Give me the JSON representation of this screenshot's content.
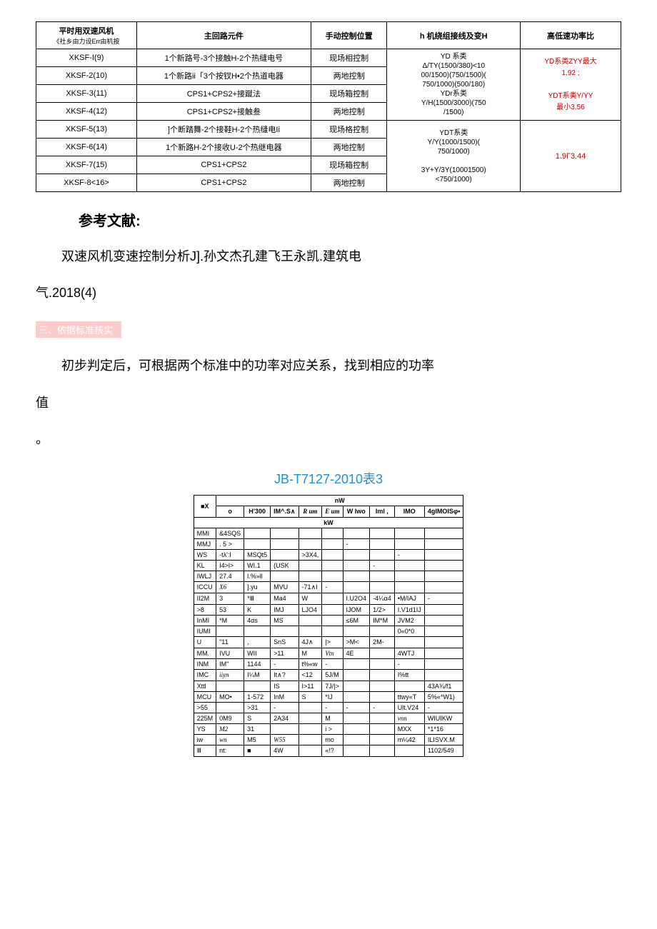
{
  "table1": {
    "headers": {
      "c1a": "平时用双速风机",
      "c1b": "《社乡由力设Err由机按",
      "c2": "主回路元件",
      "c3": "手动控制位置",
      "c4": "h 机绕组接线及变H",
      "c5": "高低速功率比"
    },
    "rows": [
      {
        "c1": "XKSF-I(9)",
        "c2": "1个新路号-3个接触H-2个热缝电号",
        "c3": "现场相控制"
      },
      {
        "c1": "XKSF-2(10)",
        "c2": "1个新路ii「3个按钗H•2个热道电器",
        "c3": "两地控制"
      },
      {
        "c1": "XKSF-3(11)",
        "c2": "CPS1+CPS2+接蹴法",
        "c3": "现场箱控制"
      },
      {
        "c1": "XKSF-4(12)",
        "c2": "CPS1+CPS2+接触叁",
        "c3": "两地控制"
      },
      {
        "c1": "XKSF-5(13)",
        "c2": "]个断踏舞-2个接鞋H-2个热缝电Ii",
        "c3": "现场格控制"
      },
      {
        "c1": "XKSF-6(14)",
        "c2": "1个新路H-2个接收U-2个热继电器",
        "c3": "两地控制"
      },
      {
        "c1": "XKSF-7(15)",
        "c2": "CPS1+CPS2",
        "c3": "现场箱控制"
      },
      {
        "c1": "XKSF-8<16>",
        "c2": "CPS1+CPS2",
        "c3": "两地控制"
      }
    ],
    "group1_c4": "YD 系类\nΔ/TY(1500/380)<10\n00/1500)(750/1500)(\n750/1000)(500/180)\nYDr系类\nY/H(1500/3000)(750\n/1500)",
    "group1_c5a": "YD系类ZYY最大",
    "group1_c5b": "1.92 ;",
    "group1_c5c": "YDT系类Y/YY",
    "group1_c5d": "最小3.56",
    "group2_c4": "YDT系类\nY/Y(1000/1500)(\n750/1000)\n\n3Y+Y/3Y(10001500)\n<750/1000)",
    "group2_c5": "1.9Г3.44"
  },
  "refs_title": "参考文献:",
  "refs_line1": "双速风机变速控制分析J].孙文杰孔建飞王永凯.建筑电",
  "refs_line2": "气.2018(4)",
  "section3": "三、依据标准核实",
  "para1": "初步判定后，可根据两个标准中的功率对应关系，找到相应的功率",
  "para2": "值",
  "para3": "。",
  "figTitle": "JB-T7127-2010表3",
  "table2": {
    "headRow1": {
      "hx": "■X",
      "hnw": "nW"
    },
    "headRow2": {
      "h1": "o",
      "h2": "H'300",
      "h3": "IM^.S∧",
      "h4": "R um",
      "h5": "E um",
      "h6": "W Iwo",
      "h7": "Iml ,",
      "h8": "IMO",
      "h9": "4gIMOISφ•"
    },
    "headRow3": {
      "kw": "kW"
    },
    "rows": [
      [
        "MMI",
        "&4SQS",
        "",
        "",
        "",
        "",
        "",
        "",
        "",
        ""
      ],
      [
        "MMJ",
        ". 5 >",
        "",
        "",
        "",
        "",
        "-",
        "",
        "",
        ""
      ],
      [
        "WS",
        "-tλ':I",
        "MSQt5",
        "",
        ">3X4,",
        "",
        "",
        "",
        "-",
        ""
      ],
      [
        "KL",
        "I4>l>",
        "WI.1",
        "(USK",
        "",
        "",
        "",
        "-",
        "",
        ""
      ],
      [
        "IWLJ",
        "27.4",
        "l.%»ll",
        "",
        "",
        "",
        "",
        "",
        "",
        ""
      ],
      [
        "ICCU",
        "X6",
        "].yu",
        "MVU",
        "-71∧I",
        "-",
        "",
        "",
        "",
        ""
      ],
      [
        "II2M",
        "3",
        "*Ⅲ",
        "Ma4",
        "W",
        "",
        "I.U2O4",
        "-4¼α4",
        "•M/IAJ",
        "-"
      ],
      [
        ">8",
        "53",
        "K",
        "IMJ",
        "LJO4",
        "",
        "IJOM",
        "1/2>",
        "I.V1d1IJ",
        ""
      ],
      [
        "InMI",
        "*M",
        "4αs",
        "MS",
        "",
        "",
        "≤6M",
        "IM*M",
        "JVM2",
        ""
      ],
      [
        "IUMI",
        "",
        "",
        "",
        "",
        "",
        "",
        "",
        "0«0*0",
        ""
      ],
      [
        "U",
        "\"11",
        ",",
        "SnS",
        "4J∧",
        "|>",
        ">M<",
        "2M-",
        "",
        ""
      ],
      [
        "MM.",
        "IVU",
        "WII",
        ">11",
        "M",
        "Vtn",
        "4E",
        "",
        "4WTJ",
        ""
      ],
      [
        "INM",
        "IM\"",
        "1144",
        "-",
        "t%«w",
        "-",
        "",
        "",
        "-",
        ""
      ],
      [
        "IMC",
        "iiyn",
        "I¼M",
        "It∧?",
        "<12",
        "5J/M",
        "",
        "",
        "I%tt",
        ""
      ],
      [
        "Xttl",
        "",
        "",
        "IS",
        "I>11",
        "7J/|>",
        "",
        "",
        "",
        "43A¾/f1"
      ],
      [
        "MCU",
        "MO•",
        "1-572",
        "InM",
        "S",
        "*IJ",
        "",
        "",
        "ttwy«T",
        "5%«*W1)"
      ],
      [
        ">55",
        "",
        ">31",
        "-",
        "",
        "-",
        "-",
        "-",
        "Ult.V24",
        "-"
      ],
      [
        "225M",
        "0M9",
        "S",
        "2A34",
        "",
        "M",
        "",
        "",
        "vnn",
        "WIUIKW"
      ],
      [
        "YS",
        "M2",
        "31",
        "",
        "",
        "i >",
        "",
        "",
        "MXX",
        "*1*16"
      ],
      [
        "iw",
        "wn",
        "M5",
        "W55",
        "",
        "mo",
        "",
        "",
        "m¼42",
        "ILISVX.M"
      ],
      [
        "Ⅲ",
        "nt:",
        "■",
        "4W",
        "",
        "«!?",
        "",
        "",
        "",
        "1102/549"
      ]
    ]
  }
}
